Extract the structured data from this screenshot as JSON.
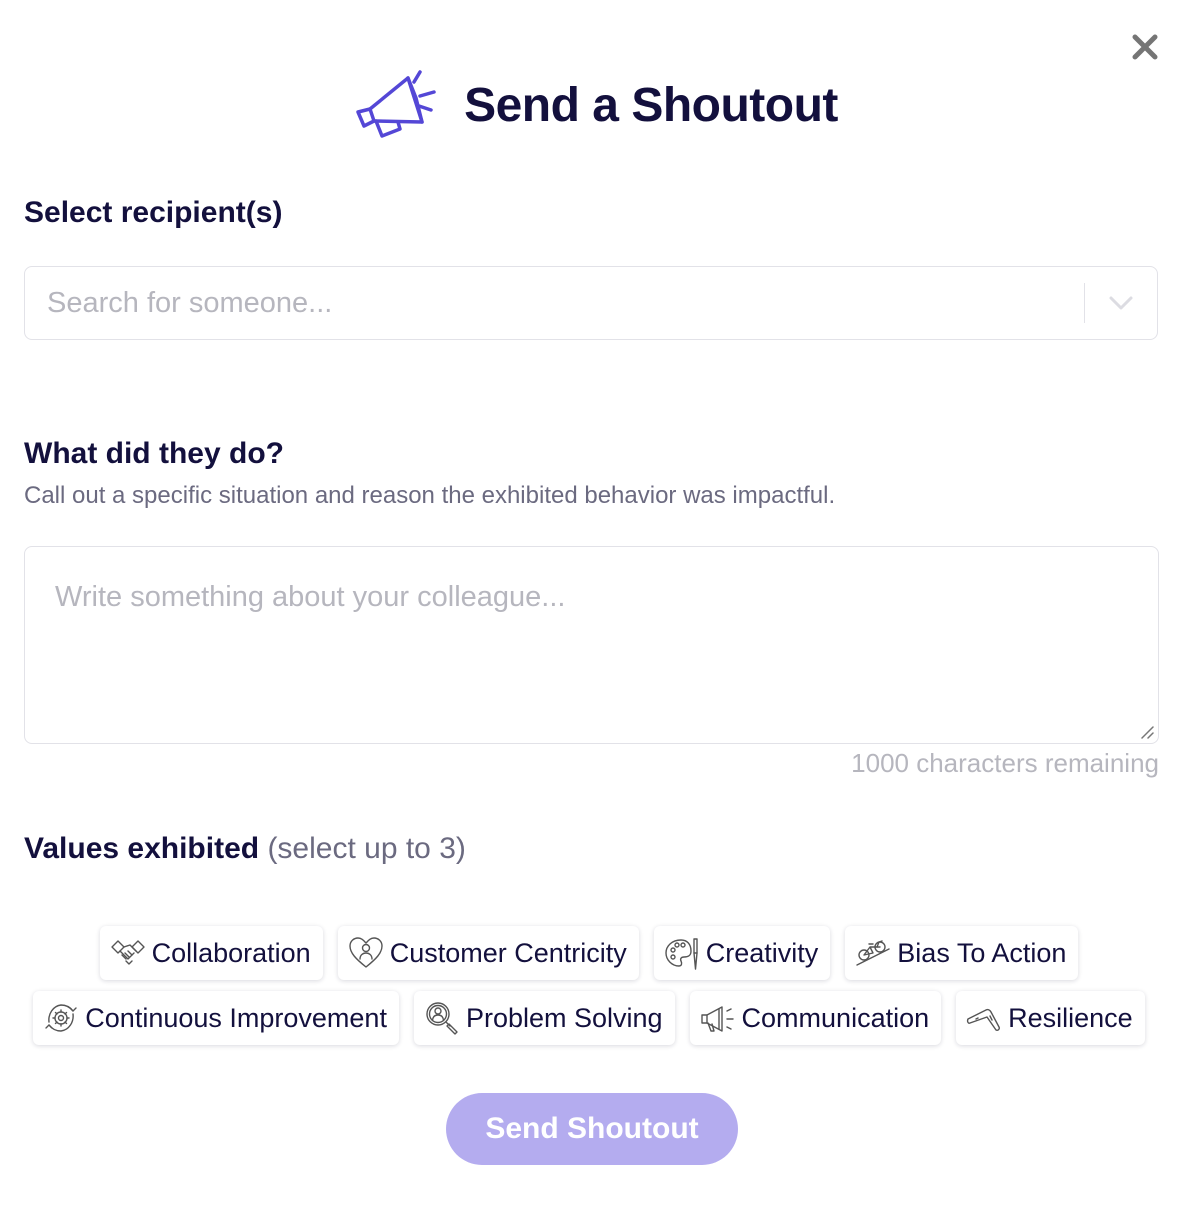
{
  "modal": {
    "title": "Send a Shoutout"
  },
  "recipients": {
    "label": "Select recipient(s)",
    "placeholder": "Search for someone..."
  },
  "description": {
    "label": "What did they do?",
    "helper": "Call out a specific situation and reason the exhibited behavior was impactful.",
    "placeholder": "Write something about your colleague...",
    "remaining": "1000 characters remaining"
  },
  "values": {
    "label": "Values exhibited",
    "hint": "(select up to 3)",
    "chips": [
      {
        "label": "Collaboration",
        "icon": "handshake-icon"
      },
      {
        "label": "Customer Centricity",
        "icon": "heart-person-icon"
      },
      {
        "label": "Creativity",
        "icon": "palette-icon"
      },
      {
        "label": "Bias To Action",
        "icon": "bicycle-icon"
      },
      {
        "label": "Continuous Improvement",
        "icon": "gear-cycle-icon"
      },
      {
        "label": "Problem Solving",
        "icon": "magnifier-person-icon"
      },
      {
        "label": "Communication",
        "icon": "megaphone-icon"
      },
      {
        "label": "Resilience",
        "icon": "boomerang-icon"
      }
    ]
  },
  "submit": {
    "label": "Send Shoutout"
  },
  "colors": {
    "accent": "#5447d6",
    "heading": "#13103d",
    "muted": "#6b6a80",
    "placeholder": "#b6b6be",
    "button_disabled": "#b4acef"
  }
}
